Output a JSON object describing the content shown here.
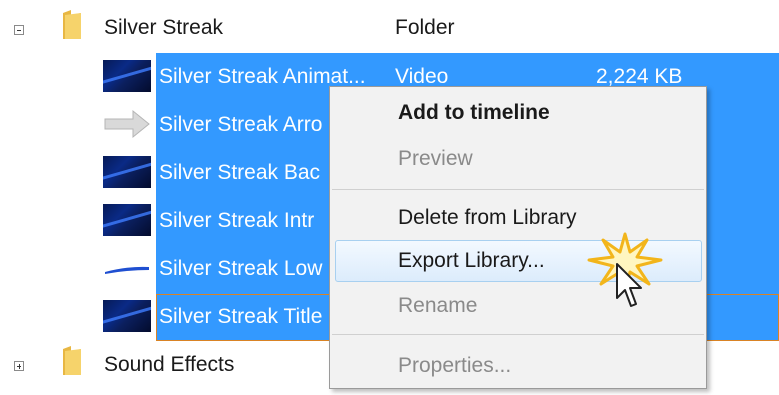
{
  "tree": {
    "folders": [
      {
        "name": "Silver Streak",
        "type": "Folder",
        "expanded": true
      },
      {
        "name": "Sound Effects",
        "type": "",
        "expanded": false
      }
    ],
    "items": [
      {
        "name": "Silver Streak Animat...",
        "type": "Video",
        "size": "2,224 KB",
        "thumb": "video"
      },
      {
        "name": "Silver Streak Arro",
        "type": "",
        "size": "",
        "thumb": "arrow"
      },
      {
        "name": "Silver Streak Bac",
        "type": "",
        "size": "",
        "thumb": "video"
      },
      {
        "name": "Silver Streak Intr",
        "type": "",
        "size": "",
        "thumb": "video"
      },
      {
        "name": "Silver Streak Low",
        "type": "",
        "size": "",
        "thumb": "lowerthird"
      },
      {
        "name": "Silver Streak Title",
        "type": "",
        "size": "",
        "thumb": "video"
      }
    ]
  },
  "context_menu": {
    "items": [
      {
        "label": "Add to timeline",
        "bold": true,
        "enabled": true
      },
      {
        "label": "Preview",
        "enabled": false
      },
      {
        "label": "Delete from Library",
        "enabled": true
      },
      {
        "label": "Export Library...",
        "enabled": true,
        "hovered": true
      },
      {
        "label": "Rename",
        "enabled": false
      },
      {
        "label": "Properties...",
        "enabled": false
      }
    ]
  },
  "colors": {
    "selection": "#3399ff",
    "focus_outline": "#d98324",
    "menu_bg": "#f2f2f2",
    "disabled_text": "#8a8a8a"
  },
  "icons": {
    "expander_collapse": "minus-box-icon",
    "expander_expand": "plus-box-icon",
    "folder": "folder-icon",
    "cursor": "arrow-cursor-icon",
    "click_burst": "click-burst-icon"
  }
}
